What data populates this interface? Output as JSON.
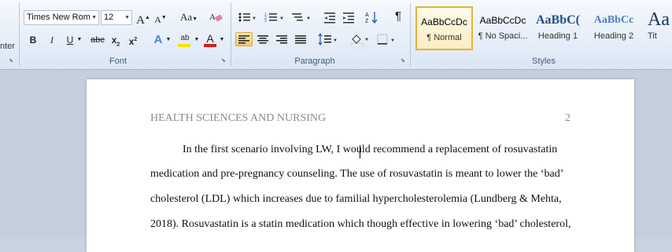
{
  "ribbon": {
    "clipboard": {
      "partial_label": "nter"
    },
    "font": {
      "group_label": "Font",
      "font_name": "Times New Rom",
      "font_size": "12",
      "grow_glyph": "A",
      "shrink_glyph": "A",
      "case_glyph": "Aa",
      "bold": "B",
      "italic": "I",
      "underline": "U",
      "strike": "abc",
      "subscript": "x",
      "superscript": "x",
      "effects_glyph": "A",
      "highlight_glyph": "ab",
      "font_color_glyph": "A",
      "highlight_color": "#f2e600",
      "font_color": "#d61b1b"
    },
    "paragraph": {
      "group_label": "Paragraph",
      "show_marks_glyph": "¶"
    },
    "styles": {
      "group_label": "Styles",
      "items": [
        {
          "sample": "AaBbCcDc",
          "name": "¶ Normal"
        },
        {
          "sample": "AaBbCcDc",
          "name": "¶ No Spaci..."
        },
        {
          "sample": "AaBbC(",
          "name": "Heading 1"
        },
        {
          "sample": "AaBbCc",
          "name": "Heading 2"
        },
        {
          "sample": "Aa",
          "name": "Tit"
        }
      ]
    }
  },
  "document": {
    "header": "HEALTH SCIENCES AND NURSING",
    "page_number": "2",
    "lines": [
      "In the first scenario involving LW, I would recommend a replacement of rosuvastatin",
      "medication and pre-pregnancy counseling. The use of rosuvastatin is meant to lower the ‘bad’",
      "cholesterol (LDL) which increases due to familial hypercholesterolemia (Lundberg & Mehta,",
      "2018). Rosuvastatin is a statin medication which though effective in lowering ‘bad’ cholesterol,"
    ]
  }
}
